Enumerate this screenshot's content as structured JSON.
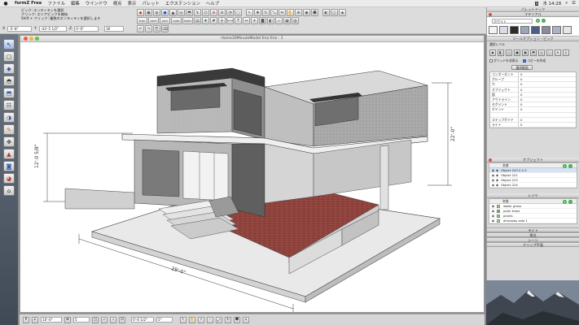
{
  "menubar": {
    "apple_icon": "apple-icon",
    "menus": [
      "formZ Free",
      "ファイル",
      "編集",
      "ウインドウ",
      "視点",
      "表示",
      "パレット",
      "エクステンション",
      "ヘルプ"
    ],
    "clock": "水 14:28",
    "status_icons": [
      "A",
      "search-icon",
      "list-icon"
    ]
  },
  "toolbar": {
    "tips": [
      "ピック: エンティティを選択",
      "クリック: エリアピックを開始",
      "Shift + クリック: 複数のエンティティを選択します"
    ],
    "coords": [
      {
        "label": "X",
        "value": "-5'-8\""
      },
      {
        "label": "Y",
        "value": "-43'-5 1/2\""
      },
      {
        "label": "Z",
        "value": "0'-0\""
      },
      {
        "label": "",
        "value": "30"
      }
    ],
    "object_buttons": [
      "tran",
      "sect",
      "pen",
      "auto",
      "hider"
    ]
  },
  "viewport": {
    "title": "Home30MinuteModel.fmz.fmz - 1"
  },
  "drawing": {
    "dim_left": "12'-0 5/8\"",
    "dim_right": "22'-0\"",
    "dim_bottom": "29'-0\""
  },
  "statusbar": {
    "fields": [
      "10'-0\"",
      "5",
      "0'-0 1/2\"",
      "5\""
    ]
  },
  "dock": {
    "title": "パレットドック",
    "materials": {
      "title": "マテリアル",
      "current": "ホワイト"
    },
    "tool_options": {
      "title": "ツールオプション・ピック",
      "section": "選択レベル",
      "check1": "グリッドを非表示",
      "check2": "コピーを作成",
      "button": "選択範囲",
      "counts": [
        {
          "k": "コンポーネント",
          "v": "0"
        },
        {
          "k": "グループ",
          "v": "0"
        },
        {
          "k": "穴",
          "v": "0"
        },
        {
          "k": "オブジェクト",
          "v": "0"
        },
        {
          "k": "面",
          "v": "0"
        },
        {
          "k": "アウトライン",
          "v": "0"
        },
        {
          "k": "セグメント",
          "v": "0"
        },
        {
          "k": "ポイント",
          "v": "0"
        },
        {
          "k": "",
          "v": ""
        },
        {
          "k": "ステップガイド",
          "v": "0"
        },
        {
          "k": "ライト",
          "v": "0"
        }
      ]
    },
    "objects": {
      "title": "オブジェクト",
      "header": "名前",
      "items": [
        "Object 243.2.2.2",
        "Object 221",
        "Object 223",
        "Object 224"
      ]
    },
    "layers": {
      "title": "レイヤ",
      "header": "名前",
      "items": [
        "water grass",
        "palm trees",
        "plants",
        "driveway side 1"
      ]
    },
    "lights_title": "ライト",
    "views_title": "視点",
    "scenes_title": "シーン",
    "clip_title": "クリップ平面"
  },
  "colors": {
    "accent": "#3b7de0",
    "brick": "#8a3a33",
    "wall": "#c6c6c6"
  }
}
